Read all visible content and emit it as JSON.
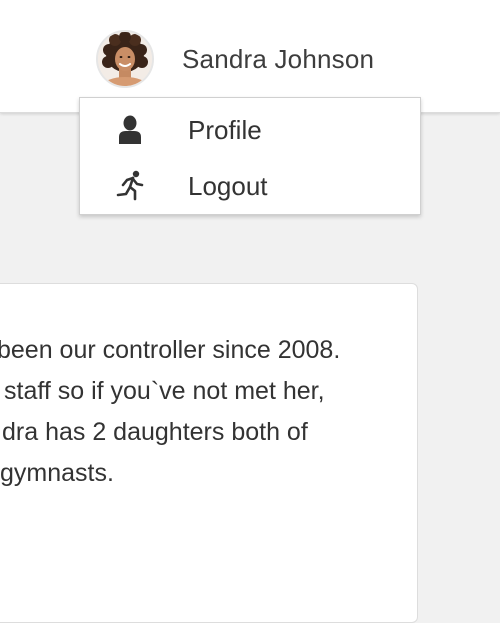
{
  "header": {
    "user": {
      "name": "Sandra Johnson",
      "avatar_icon": "user-avatar-photo"
    }
  },
  "user_menu": {
    "items": [
      {
        "label": "Profile",
        "icon": "person-icon"
      },
      {
        "label": "Logout",
        "icon": "running-person-icon"
      }
    ]
  },
  "bio_card": {
    "lines": [
      "been our controller since 2008.",
      " staff so if you`ve not met her,",
      "dra has 2 daughters both of",
      "gymnasts."
    ]
  },
  "colors": {
    "header_bg": "#ffffff",
    "page_bg": "#f1f1f1",
    "text": "#333333"
  }
}
